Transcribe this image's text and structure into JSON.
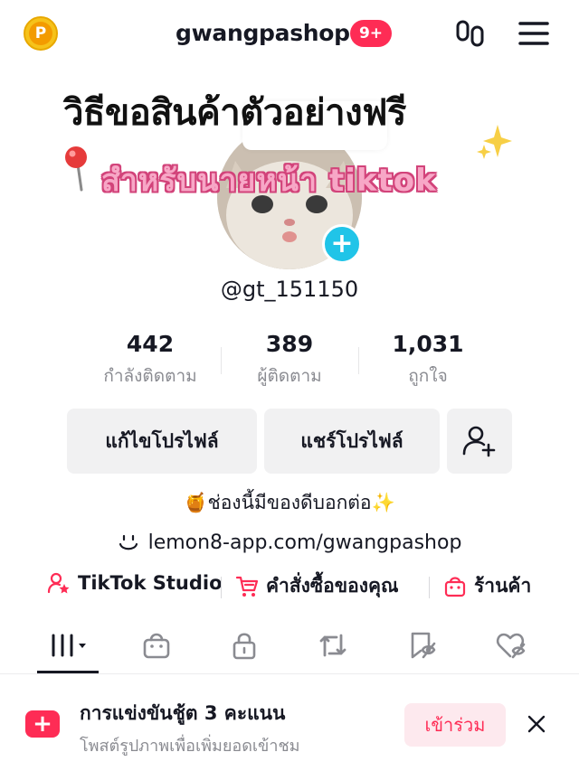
{
  "header": {
    "username": "gwangpashop",
    "notification_badge": "9+",
    "coin_letter": "P"
  },
  "overlay": {
    "title": "วิธีขอสินค้าตัวอย่างฟรี",
    "subtitle": "สำหรับนายหน้า tiktok"
  },
  "profile": {
    "handle": "@gt_151150"
  },
  "stats": [
    {
      "value": "442",
      "label": "กำลังติดตาม"
    },
    {
      "value": "389",
      "label": "ผู้ติดตาม"
    },
    {
      "value": "1,031",
      "label": "ถูกใจ"
    }
  ],
  "actions": {
    "edit_profile": "แก้ไขโปรไฟล์",
    "share_profile": "แชร์โปรไฟล์"
  },
  "bio": {
    "text": "🍯ช่องนี้มีของดีบอกต่อ✨",
    "link": "lemon8-app.com/gwangpashop"
  },
  "shortcuts": [
    {
      "label": "TikTok Studio",
      "icon": "studio-icon"
    },
    {
      "label": "คำสั่งซื้อของคุณ",
      "icon": "cart-icon"
    },
    {
      "label": "ร้านค้า",
      "icon": "shop-icon"
    }
  ],
  "tabs": [
    {
      "icon": "videos-grid-icon"
    },
    {
      "icon": "shop-bag-icon"
    },
    {
      "icon": "lock-icon"
    },
    {
      "icon": "repost-icon"
    },
    {
      "icon": "favorites-icon"
    },
    {
      "icon": "liked-icon"
    }
  ],
  "banner": {
    "title": "การแข่งขันชู้ต 3 คะแนน",
    "subtitle": "โพสต์รูปภาพเพื่อเพิ่มยอดเข้าชม",
    "join_label": "เข้าร่วม"
  },
  "colors": {
    "accent": "#fe2c55",
    "avatar_plus": "#20c4e8",
    "subtitle_fill": "#f7a7c6"
  }
}
